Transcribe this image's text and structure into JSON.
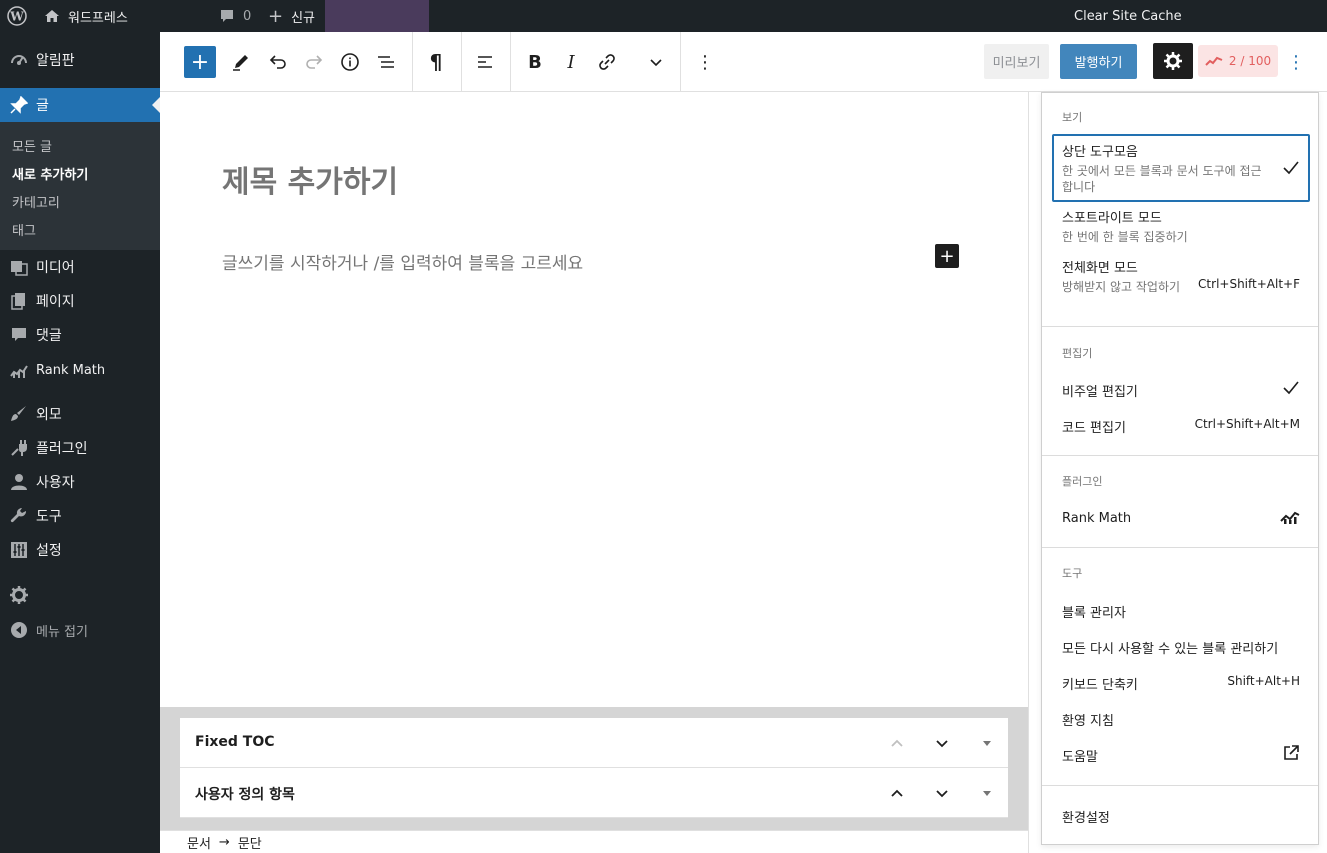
{
  "adminbar": {
    "site_name": "워드프레스",
    "comments_count": "0",
    "new_label": "신규",
    "cache_label": "Clear Site Cache"
  },
  "sidebar": {
    "items": [
      {
        "label": "알림판",
        "icon": "dashboard-icon"
      },
      {
        "label": "글",
        "icon": "pin-icon"
      },
      {
        "label": "미디어",
        "icon": "media-icon"
      },
      {
        "label": "페이지",
        "icon": "page-icon"
      },
      {
        "label": "댓글",
        "icon": "comment-icon"
      },
      {
        "label": "Rank Math",
        "icon": "rankmath-icon"
      },
      {
        "label": "외모",
        "icon": "brush-icon"
      },
      {
        "label": "플러그인",
        "icon": "plugin-icon"
      },
      {
        "label": "사용자",
        "icon": "user-icon"
      },
      {
        "label": "도구",
        "icon": "wrench-icon"
      },
      {
        "label": "설정",
        "icon": "settings-icon"
      },
      {
        "label": "메뉴 접기",
        "icon": "collapse-icon"
      }
    ],
    "submenu": [
      "모든 글",
      "새로 추가하기",
      "카테고리",
      "태그"
    ]
  },
  "toolbar": {
    "preview_label": "미리보기",
    "publish_label": "발행하기",
    "rank_score": "2 / 100"
  },
  "editor": {
    "title_placeholder": "제목 추가하기",
    "body_placeholder": "글쓰기를 시작하거나 /를 입력하여 블록을 고르세요"
  },
  "metaboxes": [
    {
      "title": "Fixed TOC"
    },
    {
      "title": "사용자 정의 항목"
    }
  ],
  "breadcrumb": {
    "root": "문서",
    "arrow": "→",
    "current": "문단"
  },
  "dropdown": {
    "view": {
      "label": "보기",
      "items": [
        {
          "label": "상단 도구모음",
          "desc": "한 곳에서 모든 블록과 문서 도구에 접근합니다"
        },
        {
          "label": "스포트라이트 모드",
          "desc": "한 번에 한 블록 집중하기"
        },
        {
          "label": "전체화면 모드",
          "desc": "방해받지 않고 작업하기",
          "shortcut": "Ctrl+Shift+Alt+F"
        }
      ]
    },
    "editor": {
      "label": "편집기",
      "items": [
        {
          "label": "비주얼 편집기"
        },
        {
          "label": "코드 편집기",
          "shortcut": "Ctrl+Shift+Alt+M"
        }
      ]
    },
    "plugins": {
      "label": "플러그인",
      "items": [
        {
          "label": "Rank Math"
        }
      ]
    },
    "tools": {
      "label": "도구",
      "items": [
        {
          "label": "블록 관리자"
        },
        {
          "label": "모든 다시 사용할 수 있는 블록 관리하기"
        },
        {
          "label": "키보드 단축키",
          "shortcut": "Shift+Alt+H"
        },
        {
          "label": "환영 지침"
        },
        {
          "label": "도움말"
        }
      ]
    },
    "preferences_label": "환경설정"
  }
}
